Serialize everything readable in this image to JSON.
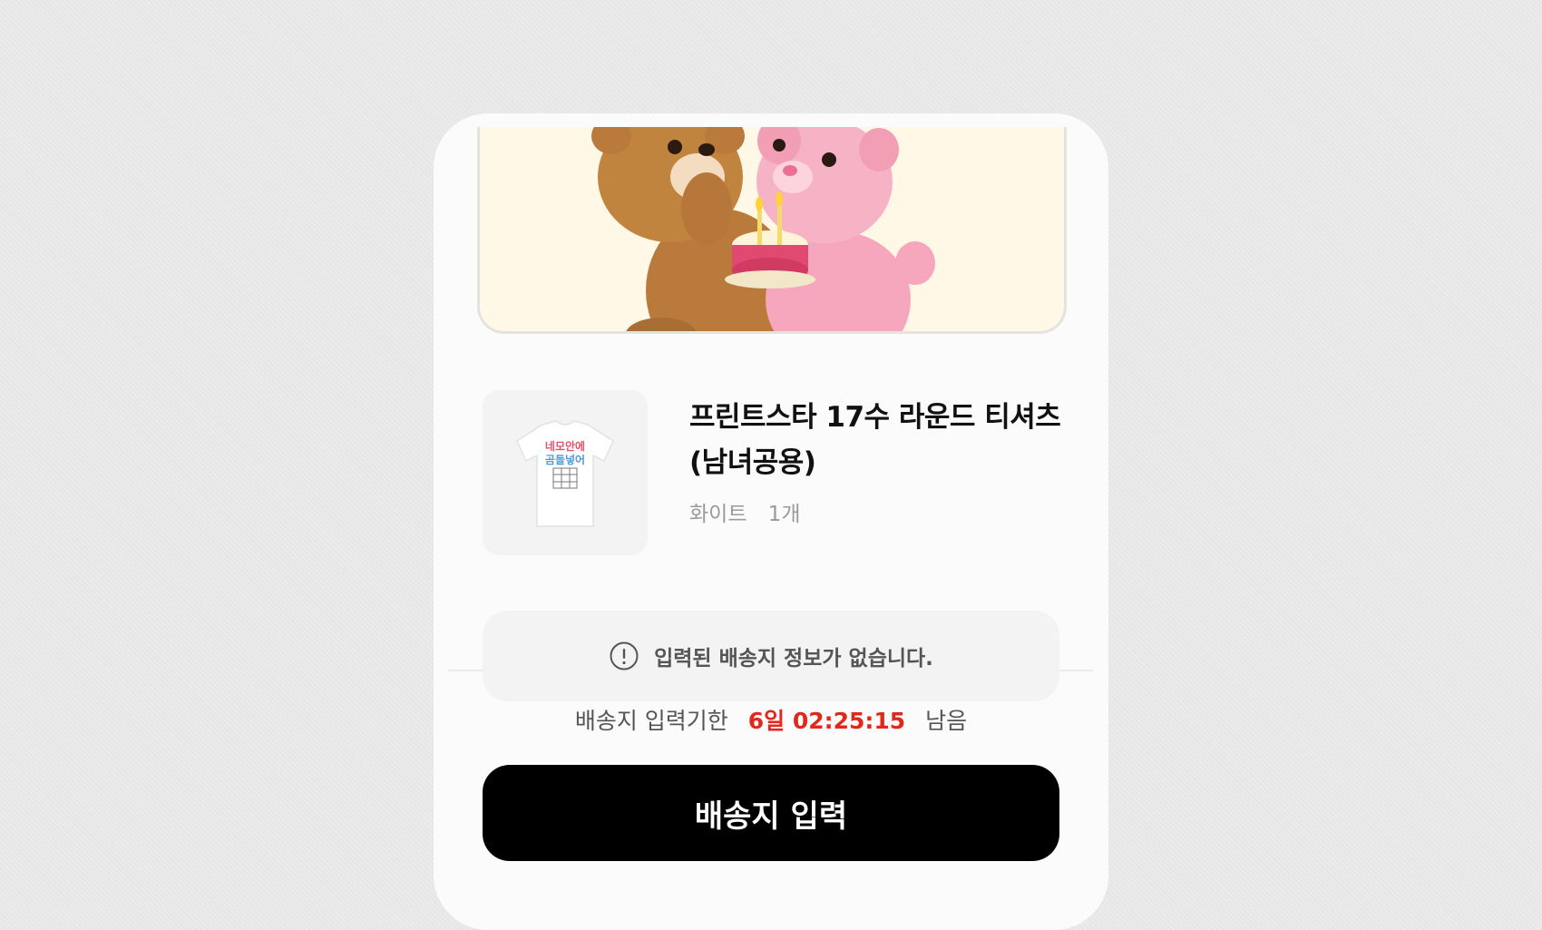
{
  "product": {
    "title": "프린트스타 17수 라운드 티셔츠(남녀공용)",
    "color": "화이트",
    "quantity": "1개",
    "shirt_print_line1": "네모안에",
    "shirt_print_line2": "곰돌넣어"
  },
  "notice": {
    "icon": "alert-circle-icon",
    "text": "입력된 배송지 정보가 없습니다."
  },
  "deadline": {
    "label": "배송지 입력기한",
    "timer": "6일 02:25:15",
    "suffix": "남음"
  },
  "cta": {
    "label": "배송지 입력"
  },
  "colors": {
    "timer": "#e0291b",
    "button": "#000000",
    "banner_bg": "#fff8e6"
  }
}
